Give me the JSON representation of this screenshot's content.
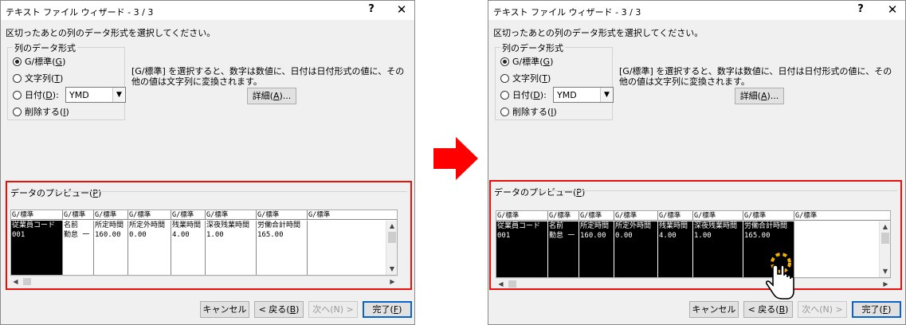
{
  "dialog": {
    "title": "テキスト ファイル ウィザード - 3 / 3",
    "help_label": "?",
    "close_label": "✕",
    "instruction": "区切ったあとの列のデータ形式を選択してください。",
    "format_group": {
      "legend": "列のデータ形式",
      "options": [
        {
          "pre": "G/標準(",
          "key": "G",
          "post": ")",
          "checked": true
        },
        {
          "pre": "文字列(",
          "key": "T",
          "post": ")",
          "checked": false
        },
        {
          "pre": "日付(",
          "key": "D",
          "post": "):",
          "checked": false
        },
        {
          "pre": "削除する(",
          "key": "I",
          "post": ")",
          "checked": false
        }
      ],
      "date_value": "YMD"
    },
    "description": "[G/標準] を選択すると、数字は数値に、日付は日付形式の値に、その他の値は文字列に変換されます。",
    "detail_button": {
      "pre": "詳細(",
      "key": "A",
      "post": ")..."
    },
    "preview": {
      "label_pre": "データのプレビュー(",
      "label_key": "P",
      "label_post": ")",
      "headers": [
        "G/標準",
        "G/標準",
        "G/標準",
        "G/標準",
        "G/標準",
        "G/標準",
        "G/標準",
        "G/標準"
      ],
      "columns": [
        [
          "従業員コード",
          "001"
        ],
        [
          "名前",
          "勤怠 一"
        ],
        [
          "所定時間",
          "160.00"
        ],
        [
          "所定外時間",
          "0.00"
        ],
        [
          "残業時間",
          "4.00"
        ],
        [
          "深夜残業時間",
          "1.00"
        ],
        [
          "労働合計時間",
          "165.00"
        ],
        []
      ]
    },
    "buttons": {
      "cancel": "キャンセル",
      "back": {
        "pre": "< 戻る(",
        "key": "B",
        "post": ")"
      },
      "next": "次へ(N) >",
      "finish": {
        "pre": "完了(",
        "key": "F",
        "post": ")"
      }
    }
  },
  "colors": {
    "highlight_frame": "#e8100a",
    "arrow": "#ff0000",
    "default_button_border": "#0a64c8",
    "cursor_click_ring": "#f0b000"
  }
}
